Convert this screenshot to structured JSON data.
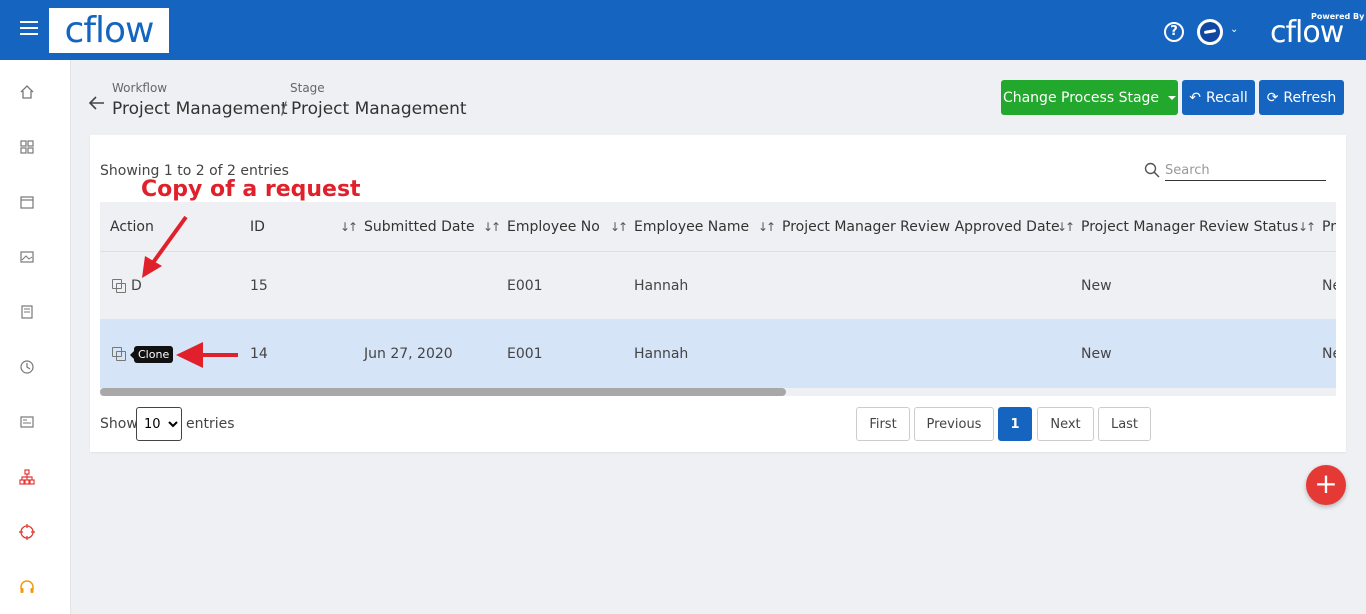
{
  "header": {
    "logo": "cflow",
    "powered_by": "Powered By",
    "powered_logo": "cflow"
  },
  "breadcrumb": {
    "workflow_label": "Workflow",
    "workflow_value": "Project Management",
    "separator": "/",
    "stage_label": "Stage",
    "stage_value": "Project Management"
  },
  "toolbar": {
    "change_stage": "Change Process Stage",
    "recall": "Recall",
    "refresh": "Refresh"
  },
  "table": {
    "showing": "Showing 1 to 2 of 2 entries",
    "search_placeholder": "Search",
    "columns": [
      "Action",
      "ID",
      "Submitted Date",
      "Employee No",
      "Employee Name",
      "Project Manager Review Approved Date",
      "Project Manager Review Status",
      "Pr"
    ],
    "rows": [
      {
        "action": "D",
        "id": "15",
        "submitted_date": "",
        "employee_no": "E001",
        "employee_name": "Hannah",
        "approved_date": "",
        "status": "New",
        "extra": "Ne"
      },
      {
        "action": "Clone",
        "id": "14",
        "submitted_date": "Jun 27, 2020",
        "employee_no": "E001",
        "employee_name": "Hannah",
        "approved_date": "",
        "status": "New",
        "extra": "Ne"
      }
    ]
  },
  "annotation": {
    "text": "Copy of a request"
  },
  "pagination": {
    "show_label": "Show",
    "page_size": "10",
    "entries_label": "entries",
    "first": "First",
    "previous": "Previous",
    "current": "1",
    "next": "Next",
    "last": "Last"
  },
  "fab": "+",
  "colors": {
    "brand": "#1565c0",
    "green": "#22a82c",
    "annotation": "#e0202a",
    "selected_row": "#d6e4f8"
  }
}
